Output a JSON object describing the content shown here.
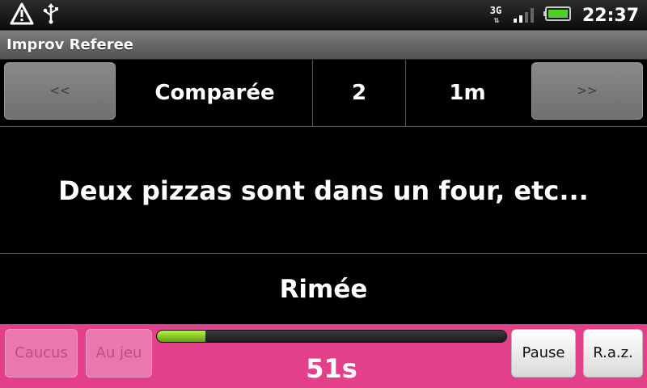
{
  "status_bar": {
    "time": "22:37",
    "network": "3G",
    "icons": [
      "warning-icon",
      "usb-icon",
      "signal-icon",
      "battery-icon"
    ],
    "battery_level": 0.9
  },
  "app": {
    "title": "Improv Referee"
  },
  "controls": {
    "prev_label": "<<",
    "next_label": ">>",
    "category": "Comparée",
    "players": "2",
    "duration": "1m"
  },
  "theme": {
    "text": "Deux pizzas sont dans un four, etc...",
    "next_category": "Rimée"
  },
  "bottom": {
    "caucus_label": "Caucus",
    "aujeu_label": "Au jeu",
    "pause_label": "Pause",
    "raz_label": "R.a.z.",
    "timer": "51s",
    "progress": 0.14
  },
  "colors": {
    "accent": "#e33f8b",
    "progress": "#8fd01f"
  }
}
